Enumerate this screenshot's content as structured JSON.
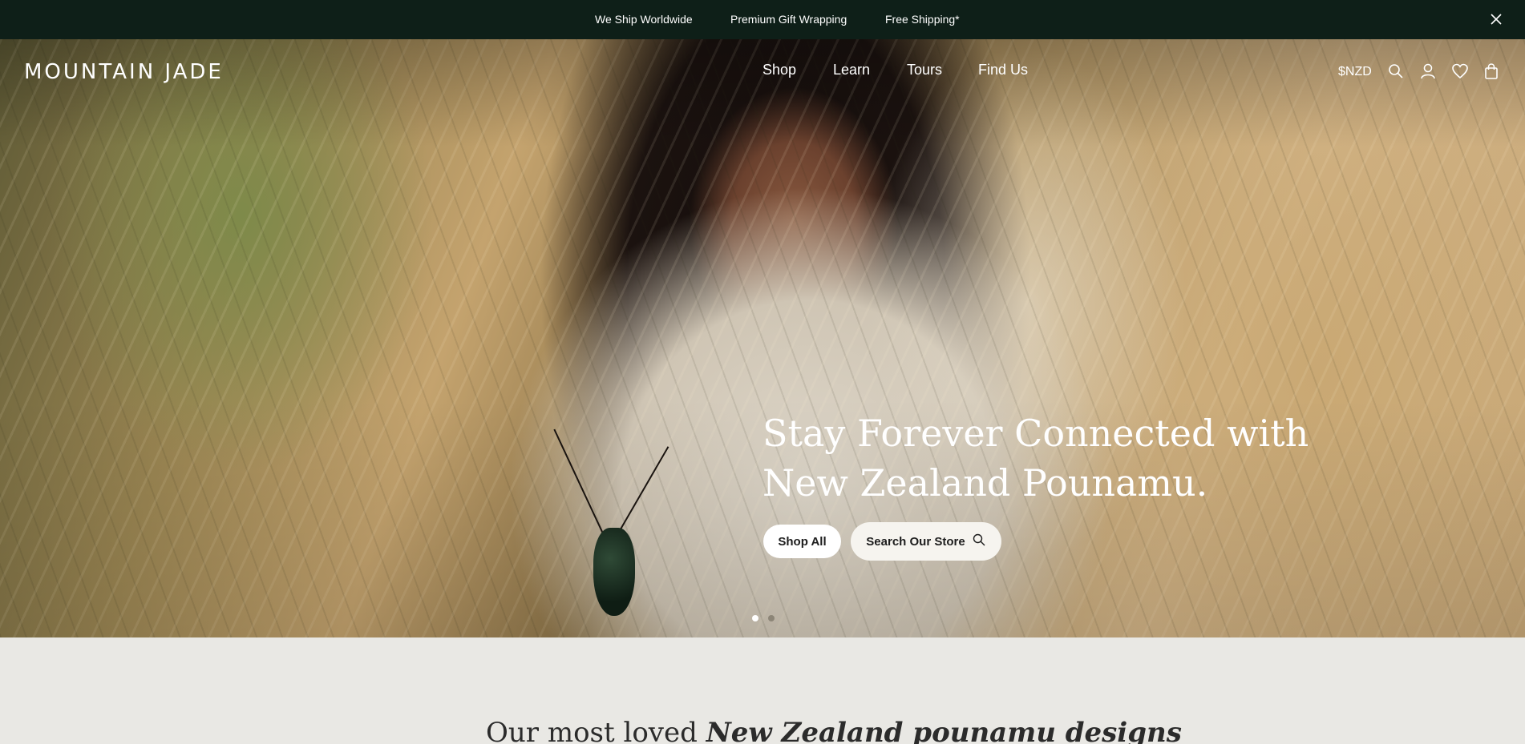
{
  "announcement": {
    "items": [
      "We Ship Worldwide",
      "Premium Gift Wrapping",
      "Free Shipping*"
    ],
    "close_icon": "close-icon"
  },
  "header": {
    "logo": "MOUNTAIN JADE",
    "nav": [
      "Shop",
      "Learn",
      "Tours",
      "Find Us"
    ],
    "currency": "$NZD",
    "icons": [
      "search-icon",
      "account-icon",
      "wishlist-icon",
      "cart-icon"
    ]
  },
  "hero": {
    "headline_line1": "Stay Forever Connected with",
    "headline_line2": "New Zealand Pounamu.",
    "shop_all": "Shop All",
    "search_store": "Search Our Store",
    "slide_count": 2,
    "active_slide": 1
  },
  "section": {
    "title_plain": "Our most loved",
    "title_emphasis": "New Zealand pounamu designs"
  },
  "colors": {
    "announcement_bg": "#0e1f18",
    "page_bg": "#e9e8e4",
    "text_light": "#ffffff",
    "button_bg": "#ffffff",
    "dot_inactive": "#8c8577"
  }
}
